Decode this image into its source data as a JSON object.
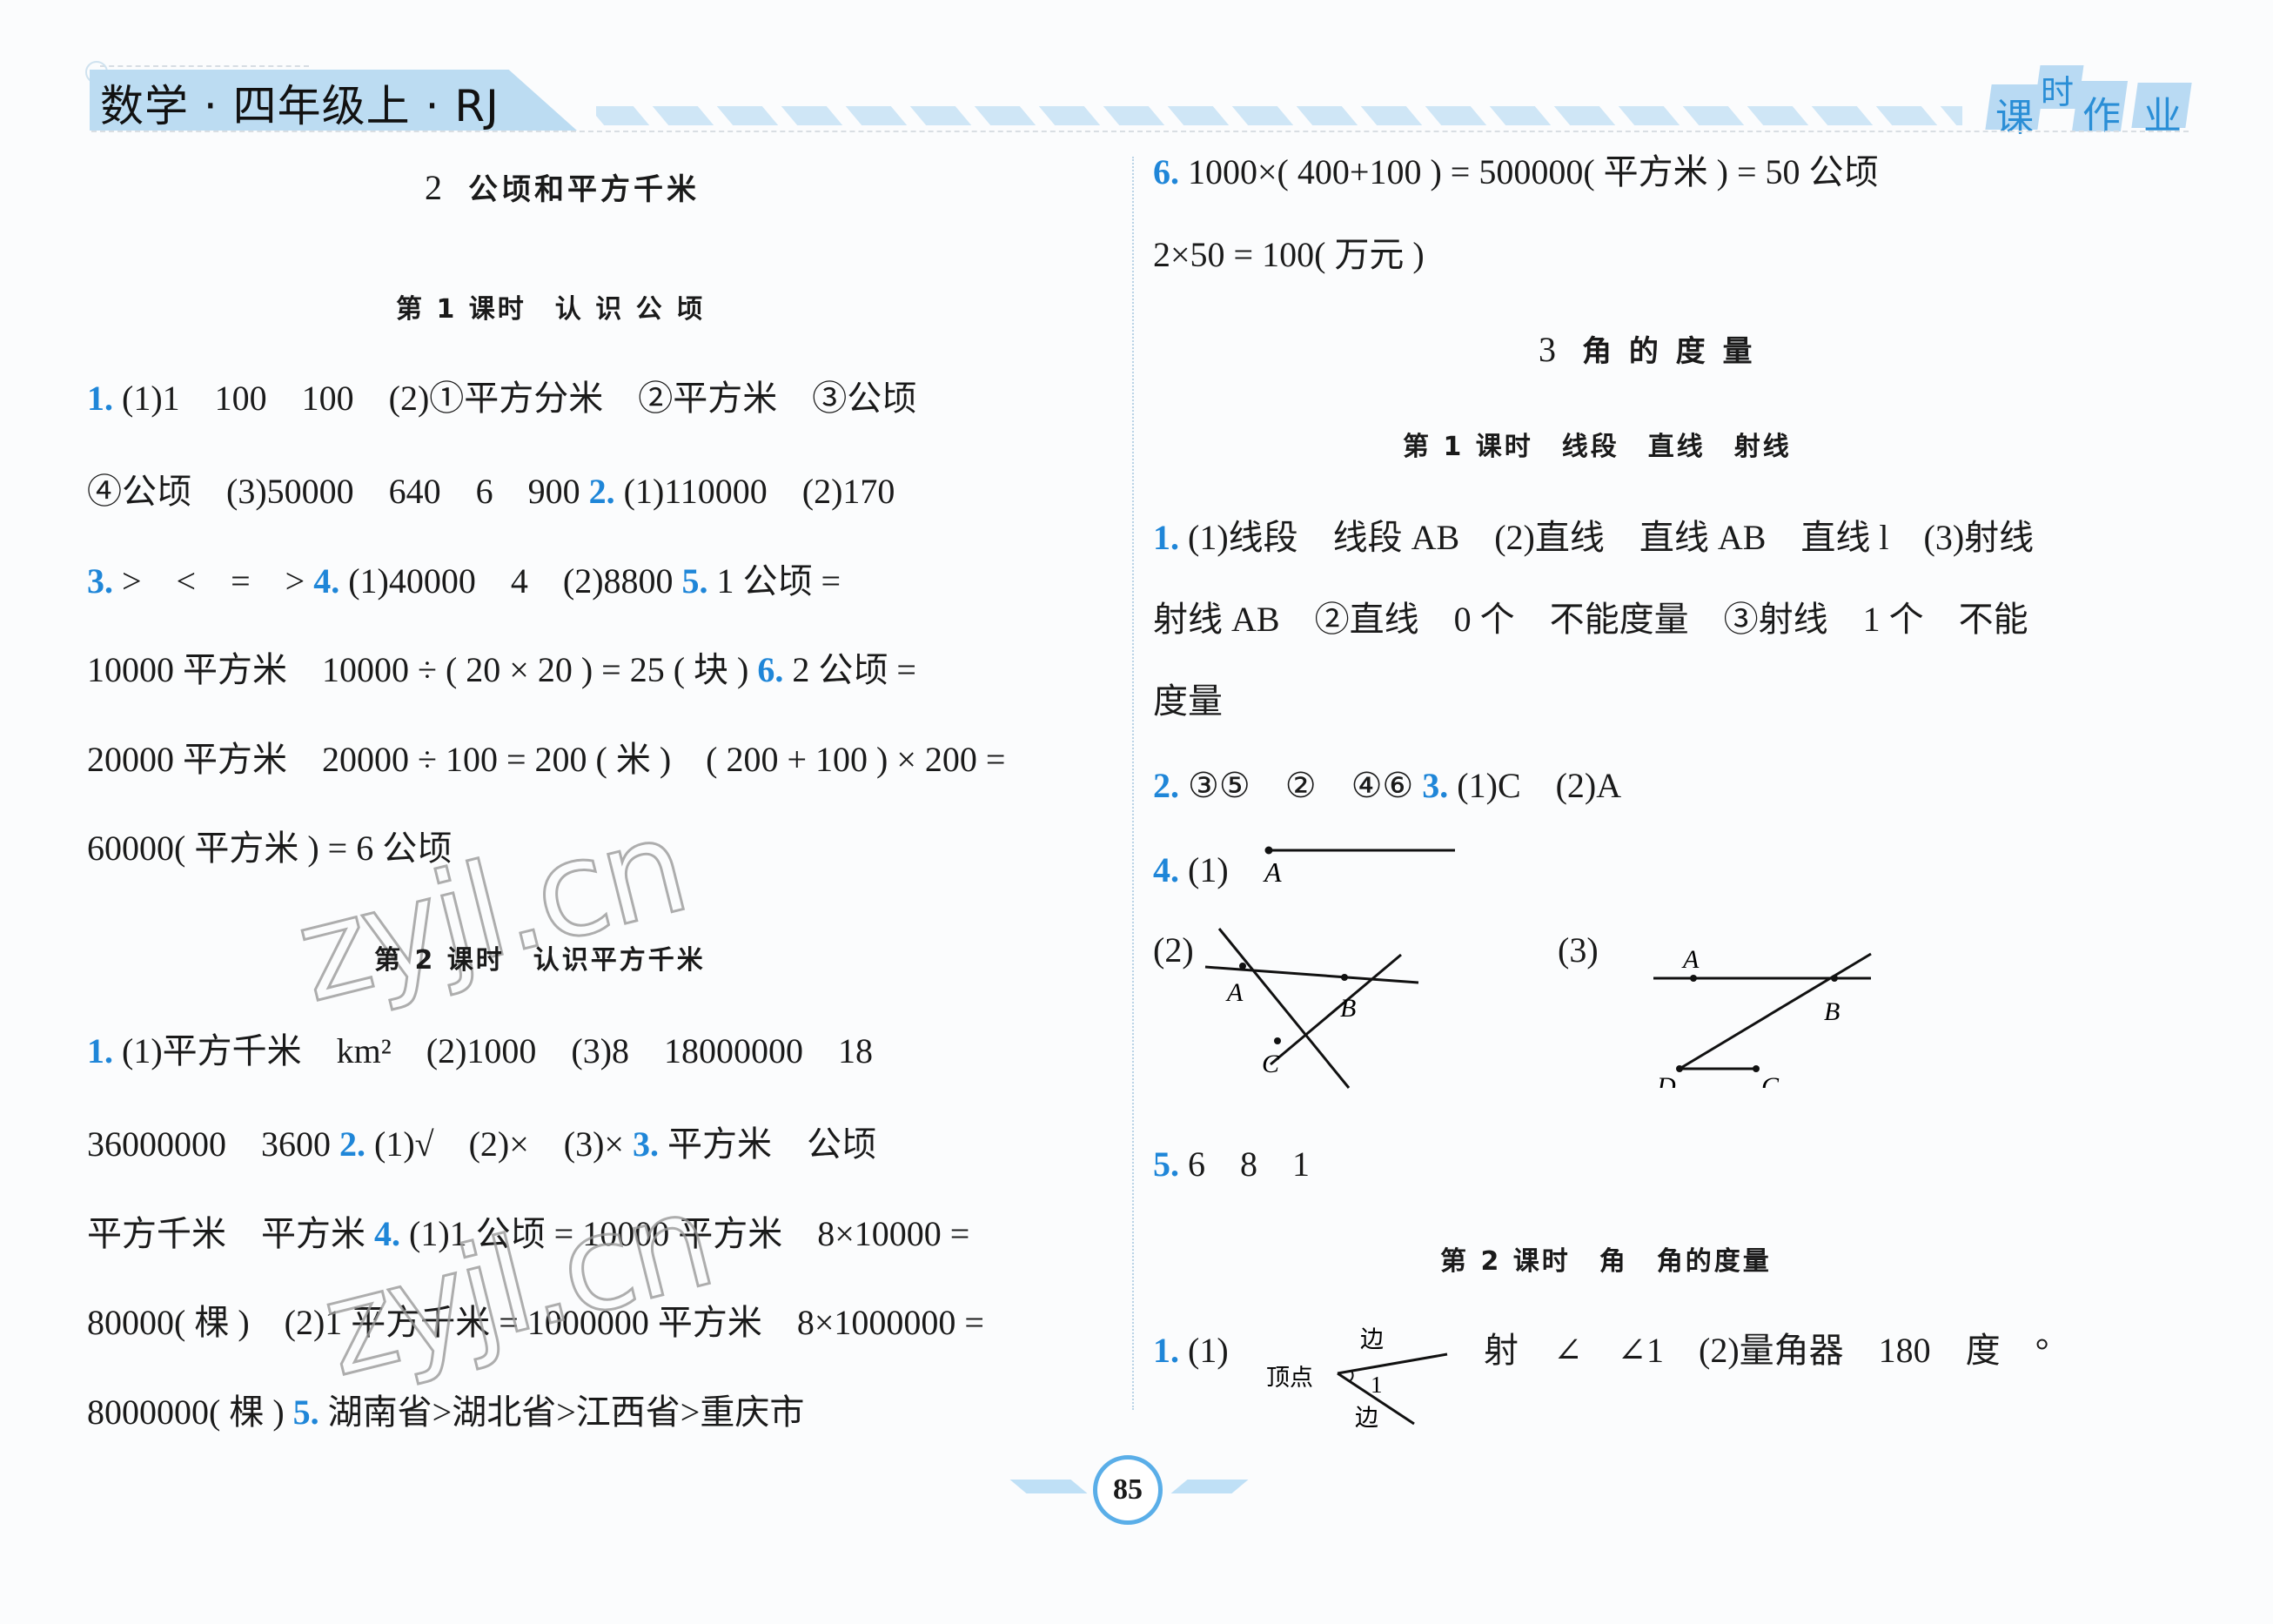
{
  "header": {
    "book_title": "数学 · 四年级上 · RJ",
    "brand_chars": [
      "课",
      "时",
      "作",
      "业"
    ]
  },
  "left": {
    "chapter": {
      "num": "2",
      "title": "公顷和平方千米"
    },
    "lesson1": {
      "title": "第 1 课时　认 识 公 顷",
      "lines": [
        {
          "q": "1.",
          "text": "(1)1　100　100　(2)①平方分米　②平方米　③公顷"
        },
        {
          "text": "④公顷　(3)50000　640　6　900",
          "q2": "2.",
          "text2": "(1)110000　(2)170"
        },
        {
          "q": "3.",
          "text": ">　<　=　>",
          "q2": "4.",
          "text2": "(1)40000　4　(2)8800",
          "q3": "5.",
          "text3": "1 公顷 ="
        },
        {
          "text": "10000 平方米　10000 ÷ ( 20 × 20 ) = 25 ( 块 )",
          "q2": "6.",
          "text2": "2 公顷 ="
        },
        {
          "text": "20000 平方米　20000 ÷ 100 = 200 ( 米 )　( 200 + 100 ) × 200 ="
        },
        {
          "text": "60000( 平方米 ) = 6 公顷"
        }
      ]
    },
    "lesson2": {
      "title": "第 2 课时　认识平方千米",
      "lines": [
        {
          "q": "1.",
          "text": "(1)平方千米　km²　(2)1000　(3)8　18000000　18"
        },
        {
          "text": "36000000　3600",
          "q2": "2.",
          "text2": "(1)√　(2)×　(3)×",
          "q3": "3.",
          "text3": "平方米　公顷"
        },
        {
          "text": "平方千米　平方米",
          "q2": "4.",
          "text2": "(1)1 公顷 = 10000 平方米　8×10000 ="
        },
        {
          "text": "80000( 棵 )　(2)1 平方千米 = 1000000 平方米　8×1000000 ="
        },
        {
          "text": "8000000( 棵 )",
          "q2": "5.",
          "text2": "湖南省>湖北省>江西省>重庆市"
        }
      ]
    },
    "watermarks": [
      "zyjl.cn",
      "zyjl.cn"
    ]
  },
  "right": {
    "top_lines": [
      {
        "q": "6.",
        "text": "1000×( 400+100 ) = 500000( 平方米 ) = 50 公顷"
      },
      {
        "text": "2×50 = 100( 万元 )"
      }
    ],
    "chapter": {
      "num": "3",
      "title": "角 的 度 量"
    },
    "lesson1": {
      "title": "第 1 课时　线段　直线　射线",
      "lines": [
        {
          "q": "1.",
          "text": "(1)线段　线段 AB　(2)直线　直线 AB　直线 l　(3)射线"
        },
        {
          "text": "射线 AB　②直线　0 个　不能度量　③射线　1 个　不能"
        },
        {
          "text": "度量"
        },
        {
          "q": "2.",
          "text": "③⑤　②　④⑥",
          "q2": "3.",
          "text2": "(1)C　(2)A"
        },
        {
          "q": "4.",
          "text": "(1)"
        },
        {
          "q": "5.",
          "text": "6　8　1"
        }
      ],
      "fig1_label": "A",
      "fig2": {
        "label": "(2)",
        "points": [
          "A",
          "B",
          "C"
        ]
      },
      "fig3": {
        "label": "(3)",
        "points": [
          "A",
          "B",
          "D",
          "C"
        ]
      }
    },
    "lesson2": {
      "title": "第 2 课时　角　角的度量",
      "line": {
        "q": "1.",
        "text_a": "(1)",
        "text_b": "射　∠　∠1　(2)量角器　180　度　°"
      },
      "angle_fig": {
        "vertex": "顶点",
        "side_top": "边",
        "side_bottom": "边",
        "angle_label": "1"
      }
    }
  },
  "footer": {
    "page_number": "85"
  },
  "colors": {
    "accent_blue": "#1f86d8",
    "banner": "#bcdcf2",
    "page_ring": "#5aaee8"
  }
}
